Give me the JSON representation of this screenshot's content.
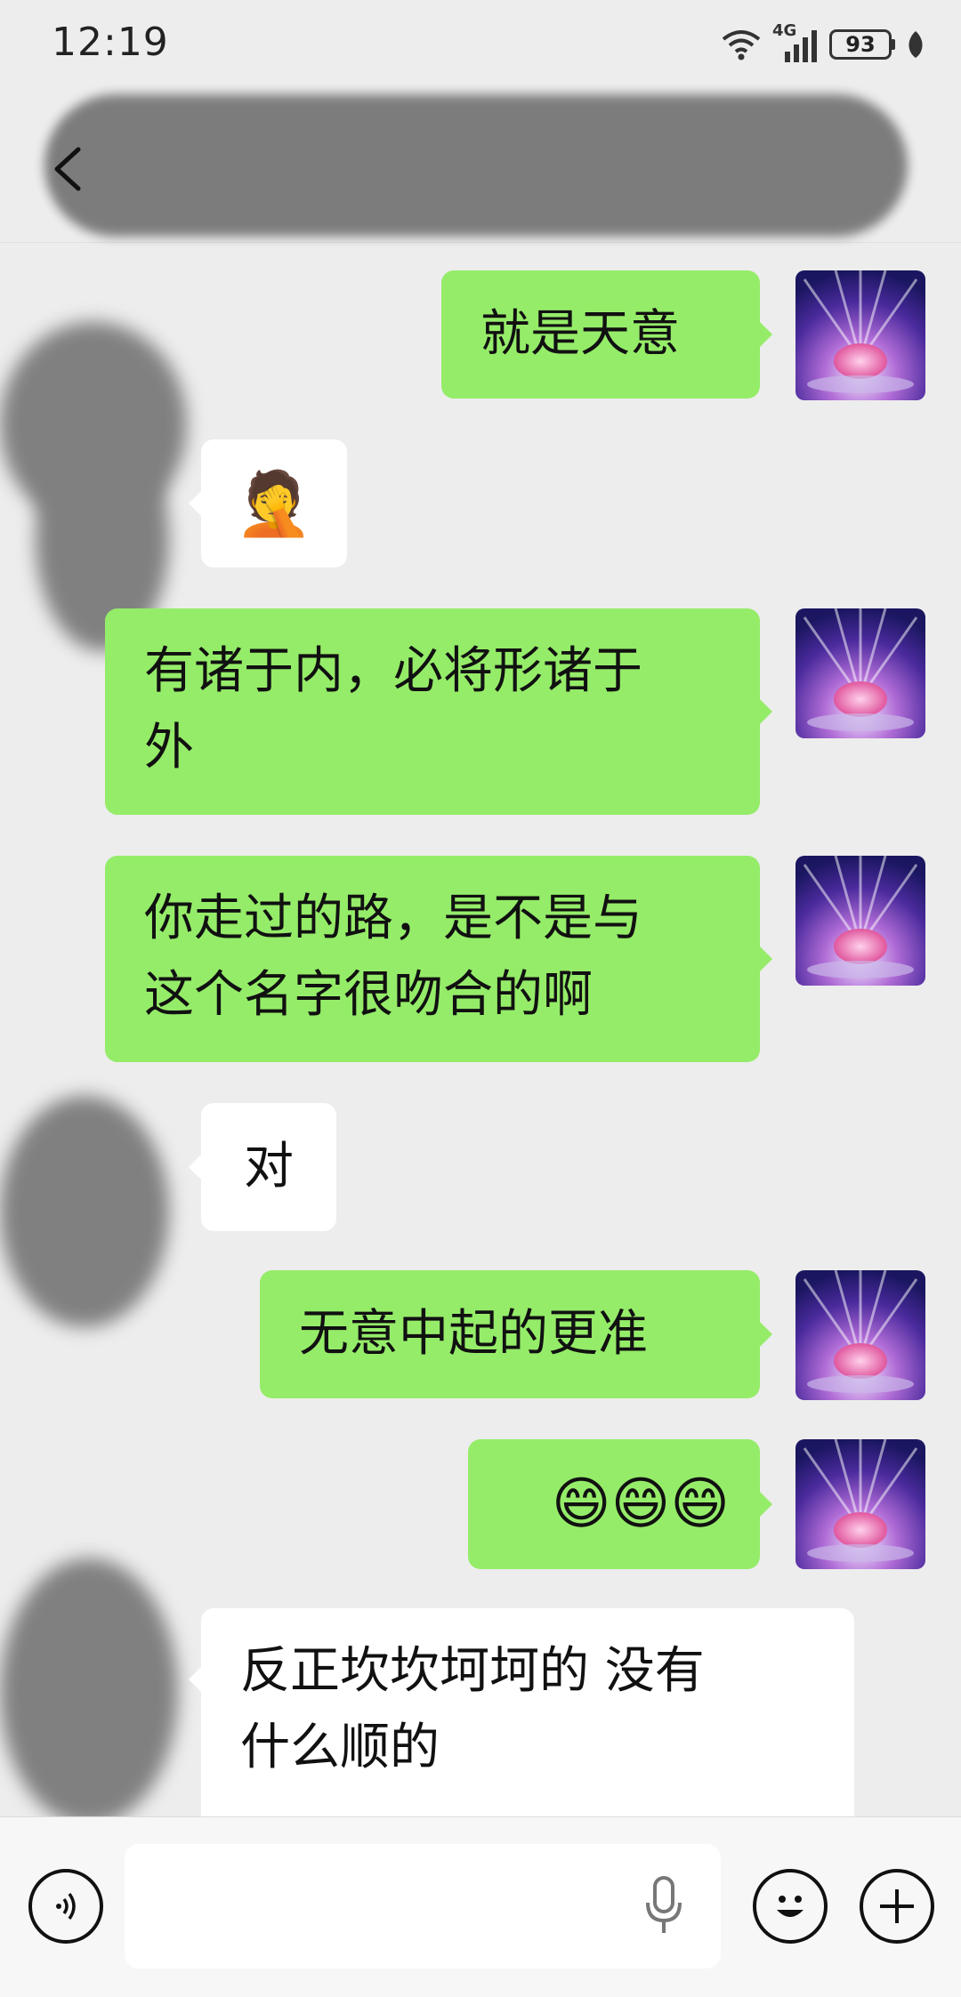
{
  "status_bar": {
    "time": "12:19",
    "network": "4G",
    "battery": "93"
  },
  "header": {
    "back_icon": "chevron-left-icon"
  },
  "messages": [
    {
      "direction": "out",
      "text": "就是天意"
    },
    {
      "direction": "in",
      "emoji": "🤦",
      "emoji_name": "facepalm-emoji"
    },
    {
      "direction": "out",
      "lines": [
        "有诸于内，必将形诸于",
        "外"
      ]
    },
    {
      "direction": "out",
      "lines": [
        "你走过的路，是不是与",
        "这个名字很吻合的啊"
      ]
    },
    {
      "direction": "in",
      "text": "对"
    },
    {
      "direction": "out",
      "text": "无意中起的更准"
    },
    {
      "direction": "out",
      "emoji": "😄😄😄",
      "emoji_name": "grin-emoji-x3"
    },
    {
      "direction": "in",
      "lines": [
        "反正坎坎坷坷的 没有",
        "什么顺的"
      ]
    }
  ],
  "input_bar": {
    "voice_icon": "voice-toggle-icon",
    "mic_icon": "microphone-icon",
    "emoji_icon": "emoji-icon",
    "more_icon": "plus-icon"
  },
  "colors": {
    "background": "#ededed",
    "outgoing_bubble": "#95ec69",
    "incoming_bubble": "#ffffff"
  }
}
